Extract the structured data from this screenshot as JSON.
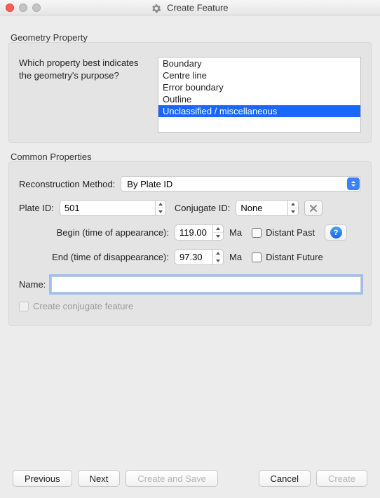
{
  "window": {
    "title": "Create Feature"
  },
  "geometry": {
    "legend": "Geometry Property",
    "prompt": "Which property best indicates the geometry's purpose?",
    "options": [
      "Boundary",
      "Centre line",
      "Error boundary",
      "Outline",
      "Unclassified / miscellaneous"
    ],
    "selected_index": 4
  },
  "common": {
    "legend": "Common Properties",
    "recon_label": "Reconstruction Method:",
    "recon_value": "By Plate ID",
    "plate_id_label": "Plate ID:",
    "plate_id_value": "501",
    "conjugate_id_label": "Conjugate ID:",
    "conjugate_id_value": "None",
    "begin_label": "Begin (time of appearance):",
    "begin_value": "119.00",
    "end_label": "End (time of disappearance):",
    "end_value": "97.30",
    "ma_label": "Ma",
    "distant_past_label": "Distant Past",
    "distant_future_label": "Distant Future",
    "name_label": "Name:",
    "name_value": "",
    "create_conjugate_label": "Create conjugate feature"
  },
  "buttons": {
    "previous": "Previous",
    "next": "Next",
    "create_and_save": "Create and Save",
    "cancel": "Cancel",
    "create": "Create"
  }
}
